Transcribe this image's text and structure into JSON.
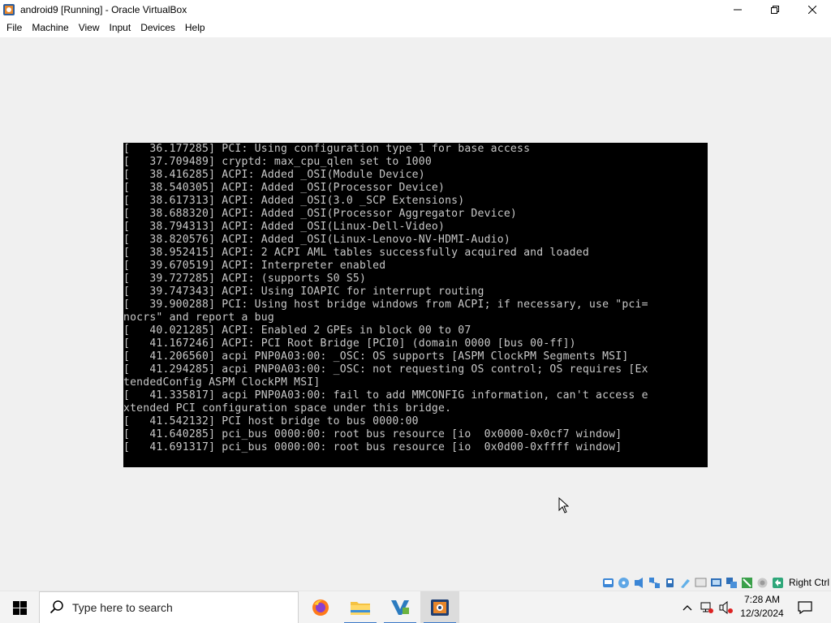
{
  "window": {
    "title": "android9 [Running] - Oracle VirtualBox"
  },
  "menu": {
    "items": [
      "File",
      "Machine",
      "View",
      "Input",
      "Devices",
      "Help"
    ]
  },
  "console": {
    "lines": [
      "[   36.177285] PCI: Using configuration type 1 for base access",
      "[   37.709489] cryptd: max_cpu_qlen set to 1000",
      "[   38.416285] ACPI: Added _OSI(Module Device)",
      "[   38.540305] ACPI: Added _OSI(Processor Device)",
      "[   38.617313] ACPI: Added _OSI(3.0 _SCP Extensions)",
      "[   38.688320] ACPI: Added _OSI(Processor Aggregator Device)",
      "[   38.794313] ACPI: Added _OSI(Linux-Dell-Video)",
      "[   38.820576] ACPI: Added _OSI(Linux-Lenovo-NV-HDMI-Audio)",
      "[   38.952415] ACPI: 2 ACPI AML tables successfully acquired and loaded",
      "[   39.670519] ACPI: Interpreter enabled",
      "[   39.727285] ACPI: (supports S0 S5)",
      "[   39.747343] ACPI: Using IOAPIC for interrupt routing",
      "[   39.900288] PCI: Using host bridge windows from ACPI; if necessary, use \"pci=",
      "nocrs\" and report a bug",
      "[   40.021285] ACPI: Enabled 2 GPEs in block 00 to 07",
      "[   41.167246] ACPI: PCI Root Bridge [PCI0] (domain 0000 [bus 00-ff])",
      "[   41.206560] acpi PNP0A03:00: _OSC: OS supports [ASPM ClockPM Segments MSI]",
      "[   41.294285] acpi PNP0A03:00: _OSC: not requesting OS control; OS requires [Ex",
      "tendedConfig ASPM ClockPM MSI]",
      "[   41.335817] acpi PNP0A03:00: fail to add MMCONFIG information, can't access e",
      "xtended PCI configuration space under this bridge.",
      "[   41.542132] PCI host bridge to bus 0000:00",
      "[   41.640285] pci_bus 0000:00: root bus resource [io  0x0000-0x0cf7 window]",
      "[   41.691317] pci_bus 0000:00: root bus resource [io  0x0d00-0xffff window]"
    ]
  },
  "statusbar": {
    "icons": [
      "hard-disk-icon",
      "optical-drive-icon",
      "audio-icon",
      "network-icon",
      "usb-icon",
      "shared-folders-icon",
      "display-icon",
      "video-capture-icon",
      "recording-icon",
      "mouse-integration-icon",
      "cpu-icon",
      "arrow-icon"
    ],
    "host_key": "Right Ctrl"
  },
  "taskbar": {
    "search_placeholder": "Type here to search",
    "apps": [
      "firefox-icon",
      "file-explorer-icon",
      "visual-studio-icon",
      "virtualbox-icon"
    ],
    "time": "7:28 AM",
    "date": "12/3/2024"
  },
  "colors": {
    "console_bg": "#000000",
    "console_text": "#c8c8c8",
    "window_bg": "#f0f0f0",
    "accent": "#3a78c8"
  }
}
